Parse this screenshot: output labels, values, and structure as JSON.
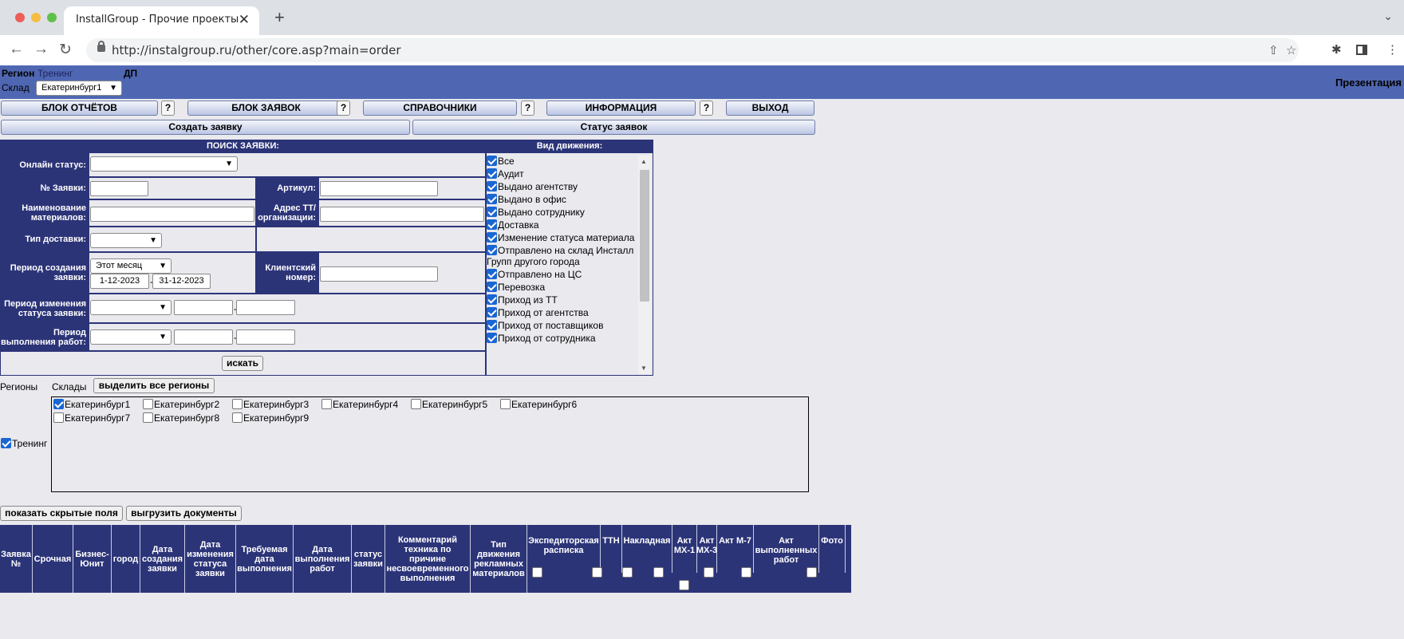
{
  "browser": {
    "tab_title": "InstallGroup - Прочие проекты",
    "url": "http://instalgroup.ru/other/core.asp?main=order",
    "close_glyph": "✕",
    "new_tab_glyph": "+",
    "back_glyph": "←",
    "forward_glyph": "→",
    "reload_glyph": "↻",
    "share_glyph": "⇧",
    "bookmark_glyph": "☆",
    "extensions_glyph": "✱",
    "menu_glyph": "⋮",
    "tabmenu_glyph": "⌄"
  },
  "header": {
    "region_label": "Регион",
    "region_value": "Тренинг",
    "dp_label": "ДП",
    "warehouse_label": "Склад",
    "warehouse_value": "Екатеринбург1",
    "presentation_link": "Презентация"
  },
  "menu": {
    "reports": "БЛОК ОТЧЁТОВ",
    "orders": "БЛОК ЗАЯВОК",
    "directories": "СПРАВОЧНИКИ",
    "information": "ИНФОРМАЦИЯ",
    "exit": "ВЫХОД",
    "help": "?",
    "create_order": "Создать заявку",
    "order_status": "Статус заявок"
  },
  "search": {
    "title": "ПОИСК ЗАЯВКИ:",
    "online_status": "Онлайн статус:",
    "order_no": "№ Заявки:",
    "article": "Артикул:",
    "material_name": "Наименование материалов:",
    "address": "Адрес ТТ/ организации:",
    "delivery_type": "Тип доставки:",
    "created_period": "Период создания заявки:",
    "period_value": "Этот месяц",
    "date_from": "1-12-2023",
    "date_to": "31-12-2023",
    "client_no": "Клиентский номер:",
    "status_change_period": "Период изменения статуса заявки:",
    "work_period": "Период выполнения работ:",
    "dash": "-",
    "search_button": "искать"
  },
  "movement": {
    "title": "Вид движения:",
    "items": [
      "Все",
      "Аудит",
      "Выдано агентству",
      "Выдано в офис",
      "Выдано сотруднику",
      "Доставка",
      "Изменение статуса материала",
      "Отправлено на склад Инсталл Групп другого города",
      "Отправлено на ЦС",
      "Перевозка",
      "Приход из ТТ",
      "Приход от агентства",
      "Приход от поставщиков",
      "Приход от сотрудника"
    ]
  },
  "regions": {
    "regions_label": "Регионы",
    "warehouses_label": "Склады",
    "select_all": "выделить все регионы",
    "region_item": "Тренинг",
    "warehouses": [
      "Екатеринбург1",
      "Екатеринбург2",
      "Екатеринбург3",
      "Екатеринбург4",
      "Екатеринбург5",
      "Екатеринбург6",
      "Екатеринбург7",
      "Екатеринбург8",
      "Екатеринбург9"
    ]
  },
  "actions": {
    "show_hidden": "показать скрытые поля",
    "export_docs": "выгрузить документы"
  },
  "results": {
    "columns": [
      "Заявка №",
      "Срочная",
      "Бизнес-Юнит",
      "город",
      "Дата создания заявки",
      "Дата изменения статуса заявки",
      "Требуемая дата выполнения",
      "Дата выполнения работ",
      "статус заявки",
      "Комментарий техника по причине несвоевременного выполнения",
      "Тип движения рекламных материалов",
      "Экспедиторская расписка",
      "ТТН",
      "Накладная",
      "Акт МХ-1",
      "Акт МХ-3",
      "Акт М-7",
      "Акт выполненных работ",
      "Фото"
    ]
  },
  "colors": {
    "header_blue": "#4f67b2",
    "navy": "#2c3478",
    "checkbox_blue": "#1a66d2"
  }
}
